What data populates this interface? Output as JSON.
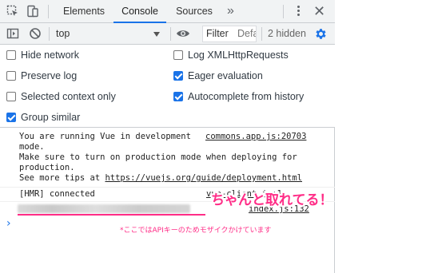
{
  "tabs": [
    {
      "label": "Elements",
      "active": false
    },
    {
      "label": "Console",
      "active": true
    },
    {
      "label": "Sources",
      "active": false
    }
  ],
  "more_tabs_glyph": "»",
  "toolbar": {
    "context": "top",
    "filter_label": "Filter",
    "filter_placeholder": "Default levels",
    "hidden": "2 hidden"
  },
  "settings": {
    "left": [
      {
        "label": "Hide network",
        "checked": false
      },
      {
        "label": "Preserve log",
        "checked": false
      },
      {
        "label": "Selected context only",
        "checked": false
      },
      {
        "label": "Group similar",
        "checked": true
      }
    ],
    "right": [
      {
        "label": "Log XMLHttpRequests",
        "checked": false
      },
      {
        "label": "Eager evaluation",
        "checked": true
      },
      {
        "label": "Autocomplete from history",
        "checked": true
      }
    ]
  },
  "console": {
    "vue_message": {
      "line1": "You are running Vue in development",
      "line2": "mode.",
      "line3": "Make sure to turn on production mode when deploying for",
      "line4": "production.",
      "line5_prefix": "See more tips at ",
      "line5_link": "https://vuejs.org/guide/deployment.html",
      "source": "commons.app.js:20703"
    },
    "hmr_message": {
      "text": "[HMR] connected",
      "source": "vue-client.js:1"
    },
    "masked_message": {
      "source": "index.js:132"
    },
    "prompt": "›"
  },
  "annotations": {
    "headline": "ちゃんと取れてる！",
    "note": "*ここではAPIキーのためモザイクかけています"
  },
  "colors": {
    "accent": "#1a73e8",
    "annotation": "#ff2d87"
  }
}
